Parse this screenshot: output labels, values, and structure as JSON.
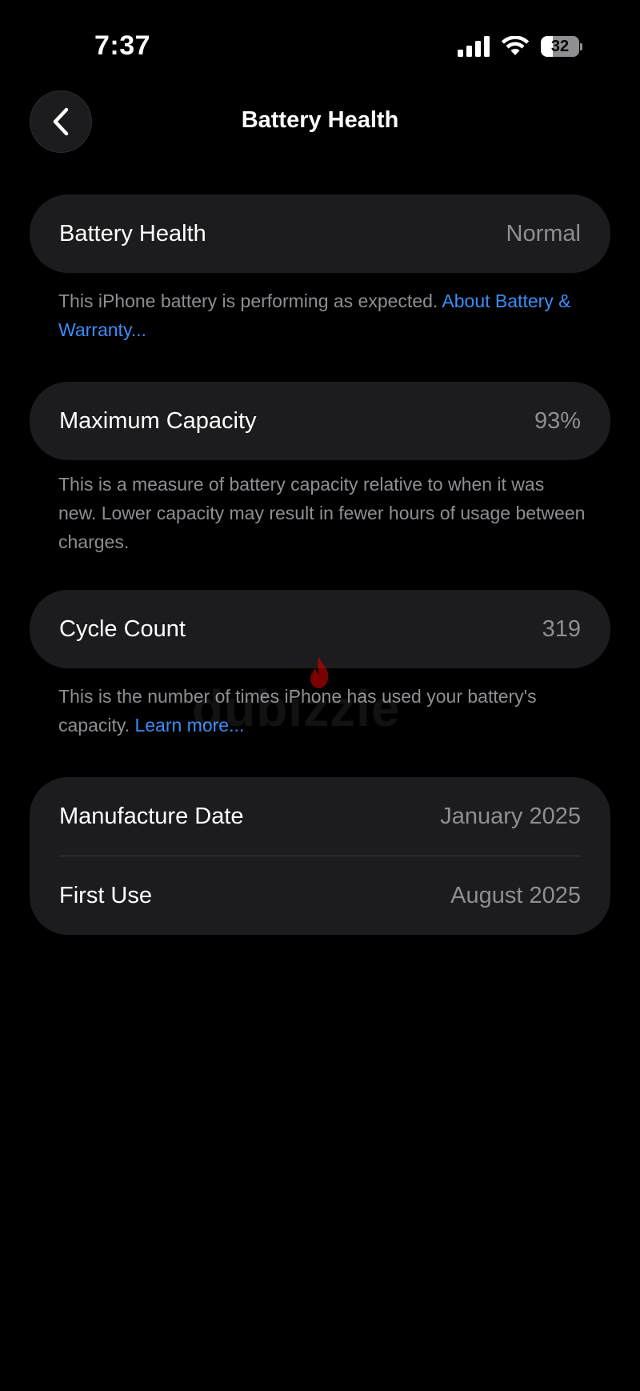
{
  "status_bar": {
    "time": "7:37",
    "battery_level": "32",
    "battery_fraction": 0.32
  },
  "nav": {
    "title": "Battery Health",
    "back_icon": "chevron-left-icon"
  },
  "battery_health": {
    "label": "Battery Health",
    "value": "Normal",
    "note": "This iPhone battery is performing as expected. ",
    "note_link": "About Battery & Warranty..."
  },
  "maximum_capacity": {
    "label": "Maximum Capacity",
    "value": "93%",
    "note": "This is a measure of battery capacity relative to when it was new. Lower capacity may result in fewer hours of usage between charges."
  },
  "cycle_count": {
    "label": "Cycle Count",
    "value": "319",
    "note": "This is the number of times iPhone has used your battery's capacity. ",
    "note_link": "Learn more..."
  },
  "dates": {
    "manufacture_label": "Manufacture Date",
    "manufacture_value": "January 2025",
    "first_use_label": "First Use",
    "first_use_value": "August 2025"
  },
  "watermark": {
    "text": "dubizzle"
  },
  "colors": {
    "background": "#000000",
    "card": "#1c1c1e",
    "secondary_text": "#8e8e93",
    "link": "#3b8cf7",
    "watermark_accent": "#e00000"
  }
}
